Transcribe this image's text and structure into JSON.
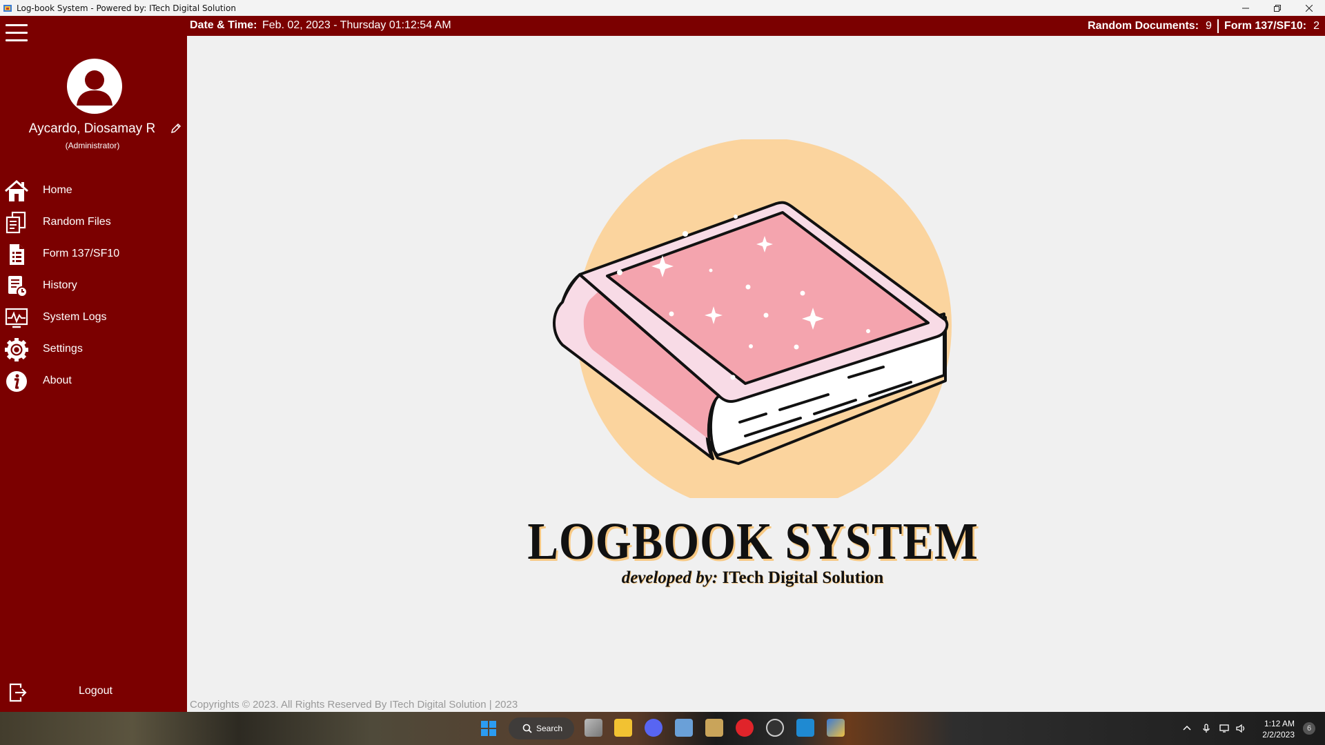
{
  "window": {
    "title": "Log-book System - Powered by: ITech Digital Solution"
  },
  "user": {
    "name": "Aycardo, Diosamay R",
    "role": "(Administrator)"
  },
  "nav": {
    "items": [
      {
        "label": "Home",
        "icon": "home-icon"
      },
      {
        "label": "Random Files",
        "icon": "random-files-icon"
      },
      {
        "label": "Form 137/SF10",
        "icon": "form-document-icon"
      },
      {
        "label": "History",
        "icon": "history-icon"
      },
      {
        "label": "System Logs",
        "icon": "system-logs-icon"
      },
      {
        "label": "Settings",
        "icon": "gear-icon"
      },
      {
        "label": "About",
        "icon": "info-icon"
      }
    ],
    "logout_label": "Logout"
  },
  "topbar": {
    "datetime_label": "Date & Time:",
    "datetime_value": "Feb. 02, 2023 - Thursday 01:12:54 AM",
    "random_docs_label": "Random Documents:",
    "random_docs_value": "9",
    "form_label": "Form 137/SF10:",
    "form_value": "2"
  },
  "main": {
    "logo_title": "LOGBOOK SYSTEM",
    "logo_sub_prefix": "developed by:",
    "logo_sub_name": "ITech Digital Solution",
    "copyright": "Copyrights © 2023. All Rights Reserved By ITech Digital Solution  |  2023"
  },
  "taskbar": {
    "search_label": "Search",
    "time": "1:12 AM",
    "date": "2/2/2023",
    "notification_count": "6"
  },
  "colors": {
    "sidebar": "#7b0000",
    "logo_circle": "#fbd49e",
    "book_cover": "#f4a4ae",
    "book_light": "#f8dbe6"
  }
}
